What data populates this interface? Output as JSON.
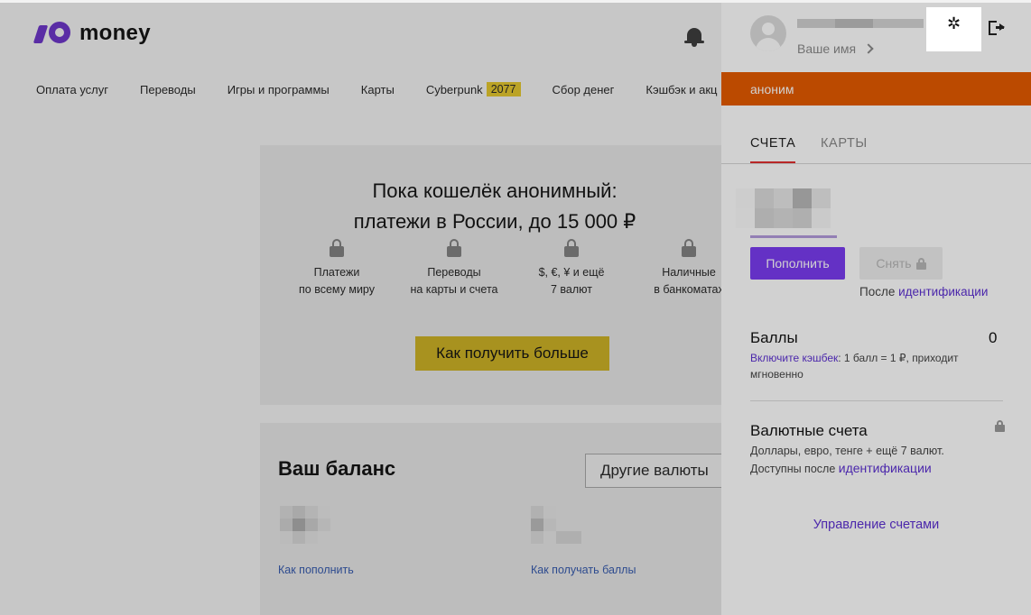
{
  "brand": {
    "name": "money"
  },
  "nav": {
    "items": [
      "Оплата услуг",
      "Переводы",
      "Игры и программы",
      "Карты",
      "Cyberpunk",
      "Сбор денег",
      "Кэшбэк и акц"
    ],
    "cyberpunk_badge": "2077"
  },
  "promo": {
    "title_line1": "Пока кошелёк анонимный:",
    "title_line2": "платежи в России, до 15 000 ₽",
    "features": [
      {
        "line1": "Платежи",
        "line2": "по всему миру"
      },
      {
        "line1": "Переводы",
        "line2": "на карты и счета"
      },
      {
        "line1": "$, €, ¥ и ещё",
        "line2": "7 валют"
      },
      {
        "line1": "Наличные",
        "line2": "в банкоматах"
      }
    ],
    "button": "Как получить больше"
  },
  "balance": {
    "title": "Ваш баланс",
    "other_currencies": "Другие валюты",
    "how_topup": "Как пополнить",
    "how_points": "Как получать баллы"
  },
  "panel": {
    "your_name": "Ваше имя",
    "status": "аноним",
    "tabs": [
      "СЧЕТА",
      "КАРТЫ"
    ],
    "topup": "Пополнить",
    "withdraw": "Снять",
    "after_prefix": "После ",
    "after_link": "идентификации",
    "points_title": "Баллы",
    "points_value": "0",
    "points_link": "Включите кэшбек",
    "points_rest": ": 1 балл = 1 ₽, приходит мгновенно",
    "currency_title": "Валютные счета",
    "currency_line1": "Доллары, евро, тенге + ещё 7 валют.",
    "currency_line2_prefix": "Доступны после ",
    "currency_link": "идентификации",
    "manage": "Управление счетами"
  },
  "icons": {
    "settings": "gear-icon",
    "exit": "exit-icon",
    "notifications": "bell-icon"
  },
  "colors": {
    "accent_purple": "#7a3cf0",
    "status_orange": "#e45a00",
    "promo_yellow": "#ffdb4d"
  }
}
